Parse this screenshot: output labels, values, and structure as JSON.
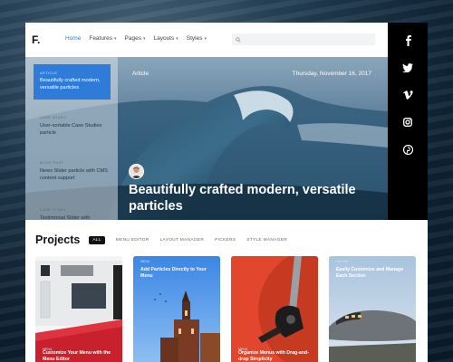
{
  "header": {
    "logo": "F.",
    "nav": [
      {
        "label": "Home",
        "active": true,
        "dropdown": false
      },
      {
        "label": "Features",
        "active": false,
        "dropdown": true
      },
      {
        "label": "Pages",
        "active": false,
        "dropdown": true
      },
      {
        "label": "Layouts",
        "active": false,
        "dropdown": true
      },
      {
        "label": "Styles",
        "active": false,
        "dropdown": true
      }
    ],
    "search_placeholder": ""
  },
  "social": [
    "facebook-icon",
    "twitter-icon",
    "vimeo-icon",
    "instagram-icon",
    "pinterest-icon"
  ],
  "slider": {
    "items": [
      {
        "category": "Article",
        "title": "Beautifully crafted modern, versatile particles",
        "active": true
      },
      {
        "category": "Case Study",
        "title": "User-sortable Case Studies particle",
        "active": false
      },
      {
        "category": "Blog Post",
        "title": "News Slider particle with CMS content support",
        "active": false
      },
      {
        "category": "Case Study",
        "title": "Testimonial Slider with",
        "active": false
      }
    ]
  },
  "hero": {
    "category": "Article",
    "date": "Thursday, November 16, 2017",
    "title": "Beautifully crafted modern, versatile particles"
  },
  "projects": {
    "title": "Projects",
    "filters": [
      "All",
      "Menu Editor",
      "Layout Manager",
      "Pickers",
      "Style Manager"
    ],
    "active_filter": "All",
    "cards": [
      {
        "title": "Customize Your Menu with the Menu Editor",
        "category": "Menu",
        "title_position": "bottom"
      },
      {
        "title": "Add Particles Directly to Your Menu",
        "category": "Menu",
        "title_position": "top"
      },
      {
        "title": "Organize Menus with Drag-and-drop Simplicity",
        "category": "Menu",
        "title_position": "bottom"
      },
      {
        "title": "Easily Customize and Manage Each Section",
        "category": "Layout",
        "title_position": "top"
      }
    ]
  },
  "colors": {
    "accent": "#2e7bd8",
    "social_bar": "#000000"
  }
}
